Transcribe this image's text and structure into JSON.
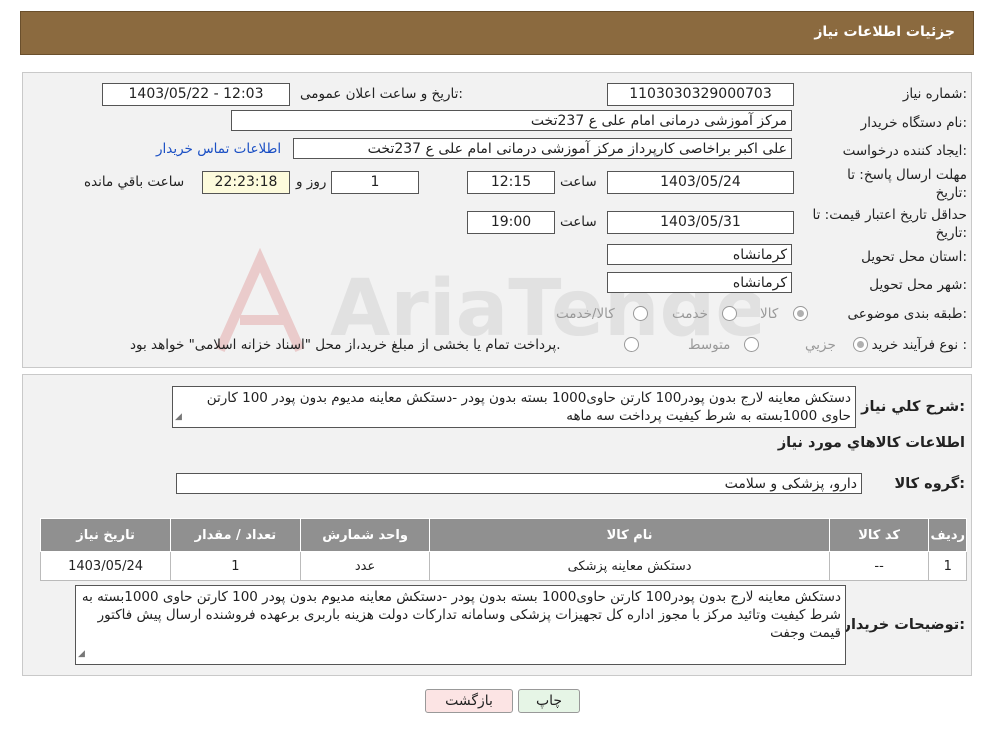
{
  "header": {
    "title": "جزئیات اطلاعات نیاز"
  },
  "fields": {
    "need_number_label": "شماره نیاز:",
    "need_number": "1103030329000703",
    "announce_label": "تاریخ و ساعت اعلان عمومی:",
    "announce_value": "1403/05/22 - 12:03",
    "buyer_org_label": "نام دستگاه خریدار:",
    "buyer_org": "مرکز آموزشی درمانی امام علی ع 237تخت",
    "creator_label": "ایجاد کننده درخواست:",
    "creator": "علی اکبر براخاصی کارپرداز  مرکز آموزشی درمانی امام علی ع 237تخت",
    "contact_link": "اطلاعات تماس خریدار",
    "deadline_label": "مهلت ارسال پاسخ: تا تاریخ:",
    "deadline_date": "1403/05/24",
    "time_label": "ساعت",
    "deadline_time": "12:15",
    "days": "1",
    "days_label": "روز و",
    "remaining": "22:23:18",
    "remaining_label": "ساعت باقي مانده",
    "validity_label": "حداقل تاریخ اعتبار قیمت: تا تاریخ:",
    "validity_date": "1403/05/31",
    "validity_time": "19:00",
    "province_label": "استان محل تحویل:",
    "province": "کرمانشاه",
    "city_label": "شهر محل تحویل:",
    "city": "کرمانشاه",
    "category_label": "طبقه بندی موضوعی:",
    "category_options": [
      "کالا",
      "خدمت",
      "کالا/خدمت"
    ],
    "process_label": "نوع فرآیند خرید :",
    "process_options": [
      "جزیي",
      "متوسط"
    ],
    "process_note": "پرداخت تمام یا بخشی از مبلغ خرید،از محل \"اسناد خزانه اسلامی\" خواهد بود."
  },
  "summary": {
    "label": "شرح كلي نياز:",
    "text": "دستکش معاینه لارج بدون پودر100 کارتن حاوی1000 بسته بدون پودر -دستکش معاینه مدیوم بدون پودر 100 کارتن حاوی  1000بسته به شرط کیفیت پرداخت سه ماهه"
  },
  "goods": {
    "title": "اطلاعات كالاهاي مورد نياز",
    "group_label": "گروه كالا:",
    "group_value": "دارو، پزشکی و سلامت",
    "columns": [
      "ردیف",
      "کد کالا",
      "نام کالا",
      "واحد شمارش",
      "تعداد / مقدار",
      "تاریخ نیاز"
    ],
    "rows": [
      [
        "1",
        "--",
        "دستکش معاینه پزشکی",
        "عدد",
        "1",
        "1403/05/24"
      ]
    ]
  },
  "buyer_notes": {
    "label": "توضیحات خریدار:",
    "text": "دستکش معاینه لارج بدون پودر100 کارتن حاوی1000 بسته بدون پودر -دستکش معاینه مدیوم بدون پودر 100 کارتن حاوی 1000بسته به شرط کیفیت وتائید مرکز با مجوز اداره کل تجهیزات پزشکی وسامانه تدارکات دولت هزینه باربری برعهده فروشنده ارسال پیش فاکتور قیمت وجفت"
  },
  "buttons": {
    "print": "چاپ",
    "back": "بازگشت"
  },
  "colors": {
    "header": "#8b6a3f",
    "table_header": "#909090",
    "link": "#1a4fc4",
    "remaining_bg": "#fdfbdc",
    "back_bg": "#fce4e4",
    "print_bg": "#e6f5e6"
  },
  "watermark": {
    "text": "AriaTender.neT"
  }
}
